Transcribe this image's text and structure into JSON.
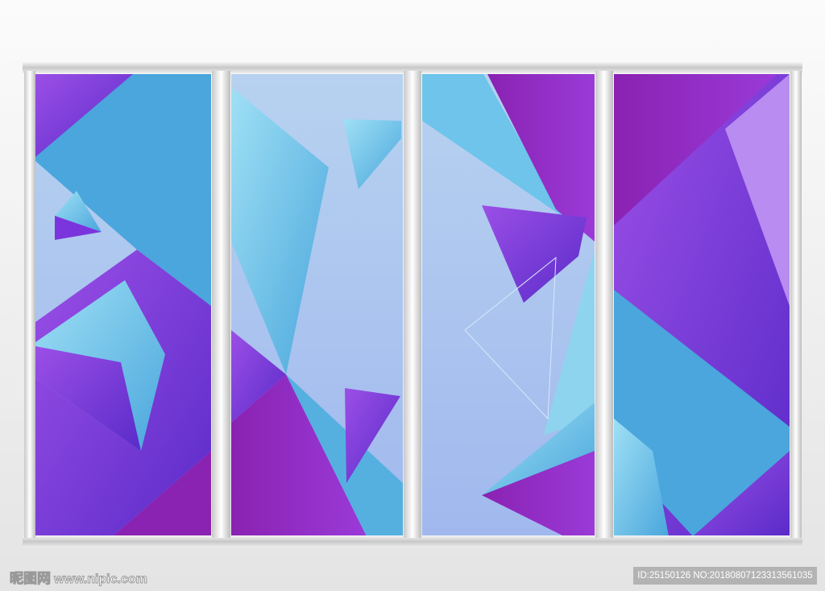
{
  "watermark": {
    "logo_text": "昵图网",
    "site": "www.nipic.com"
  },
  "image_id": "ID:25150126 NO:20180807123313561035",
  "colors": {
    "cyan": "#4aa6dc",
    "purple": "#7b35dd",
    "magenta": "#8a1fb0",
    "light": "#a8c6ee",
    "frame": "#d9d9d9"
  }
}
